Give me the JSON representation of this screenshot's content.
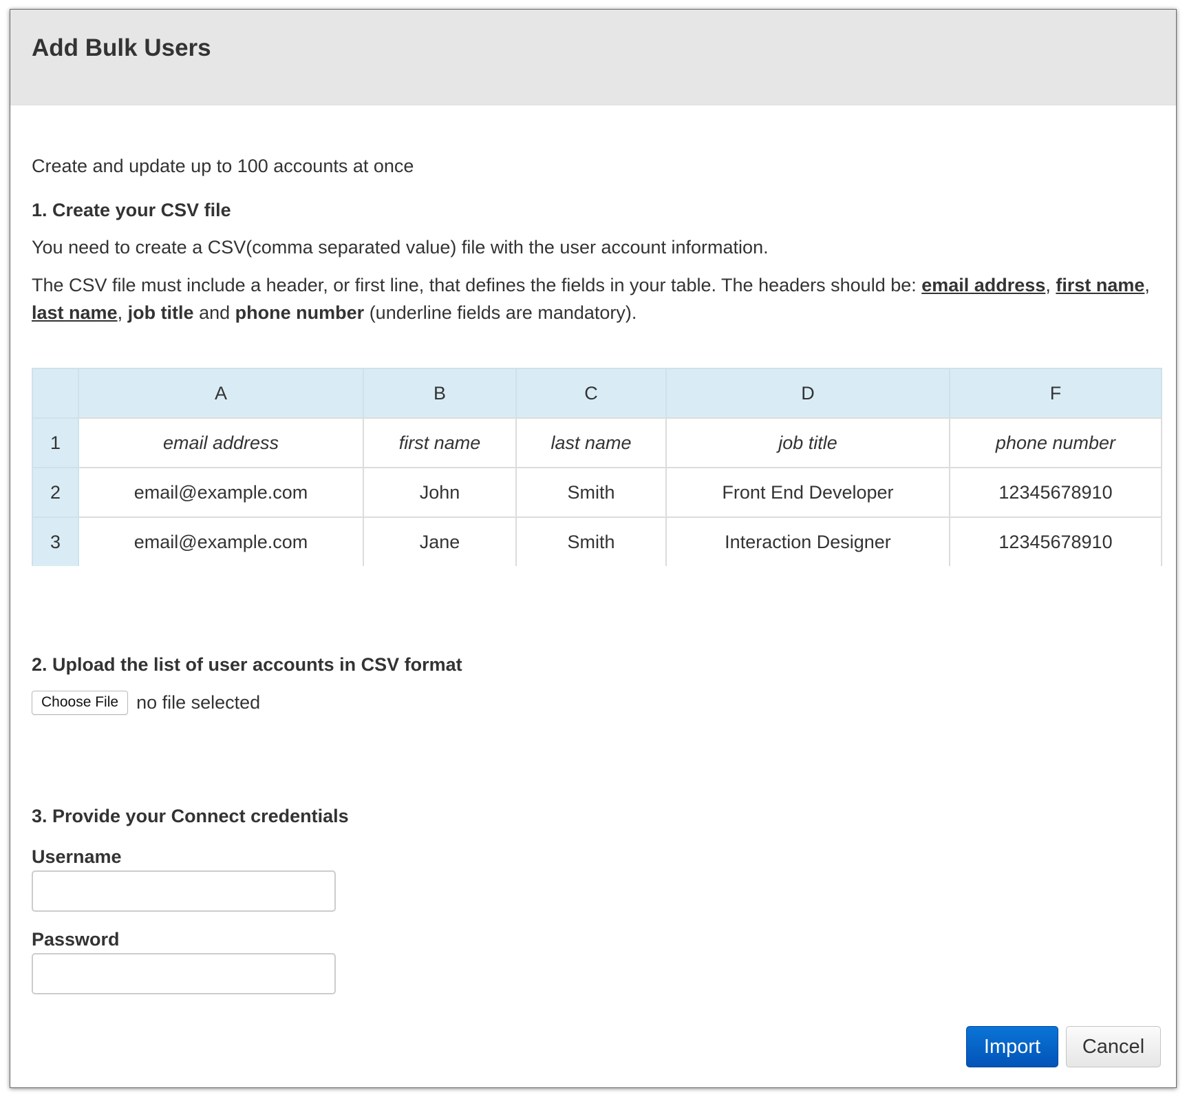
{
  "dialog": {
    "title": "Add Bulk Users",
    "intro": "Create and update up to 100 accounts at once"
  },
  "step1": {
    "heading": "1. Create your CSV file",
    "para1": "You need to create a CSV(comma separated value) file with the user account information.",
    "para2_prefix": "The CSV file must include a header, or first line, that defines the fields in your table. The headers should be: ",
    "field_email": "email address",
    "field_first": "first name",
    "field_last": "last name",
    "field_job": "job title",
    "and_text": "and",
    "field_phone": "phone number",
    "para2_suffix": "(underline fields are mandatory).",
    "table": {
      "columns": [
        "A",
        "B",
        "C",
        "D",
        "F"
      ],
      "rows": [
        {
          "num": "1",
          "cells": [
            "email address",
            "first name",
            "last name",
            "job title",
            "phone number"
          ]
        },
        {
          "num": "2",
          "cells": [
            "email@example.com",
            "John",
            "Smith",
            "Front End Developer",
            "12345678910"
          ]
        },
        {
          "num": "3",
          "cells": [
            "email@example.com",
            "Jane",
            "Smith",
            "Interaction Designer",
            "12345678910"
          ]
        }
      ]
    }
  },
  "step2": {
    "heading": "2. Upload the list of user accounts in CSV format",
    "choose_file_label": "Choose File",
    "file_status": "no file selected"
  },
  "step3": {
    "heading": "3. Provide your Connect credentials",
    "username_label": "Username",
    "username_value": "",
    "password_label": "Password",
    "password_value": ""
  },
  "actions": {
    "import_label": "Import",
    "cancel_label": "Cancel"
  },
  "colors": {
    "header_bg": "#e6e6e6",
    "table_header_bg": "#d9ecf5",
    "primary_button": "#0354b8"
  }
}
